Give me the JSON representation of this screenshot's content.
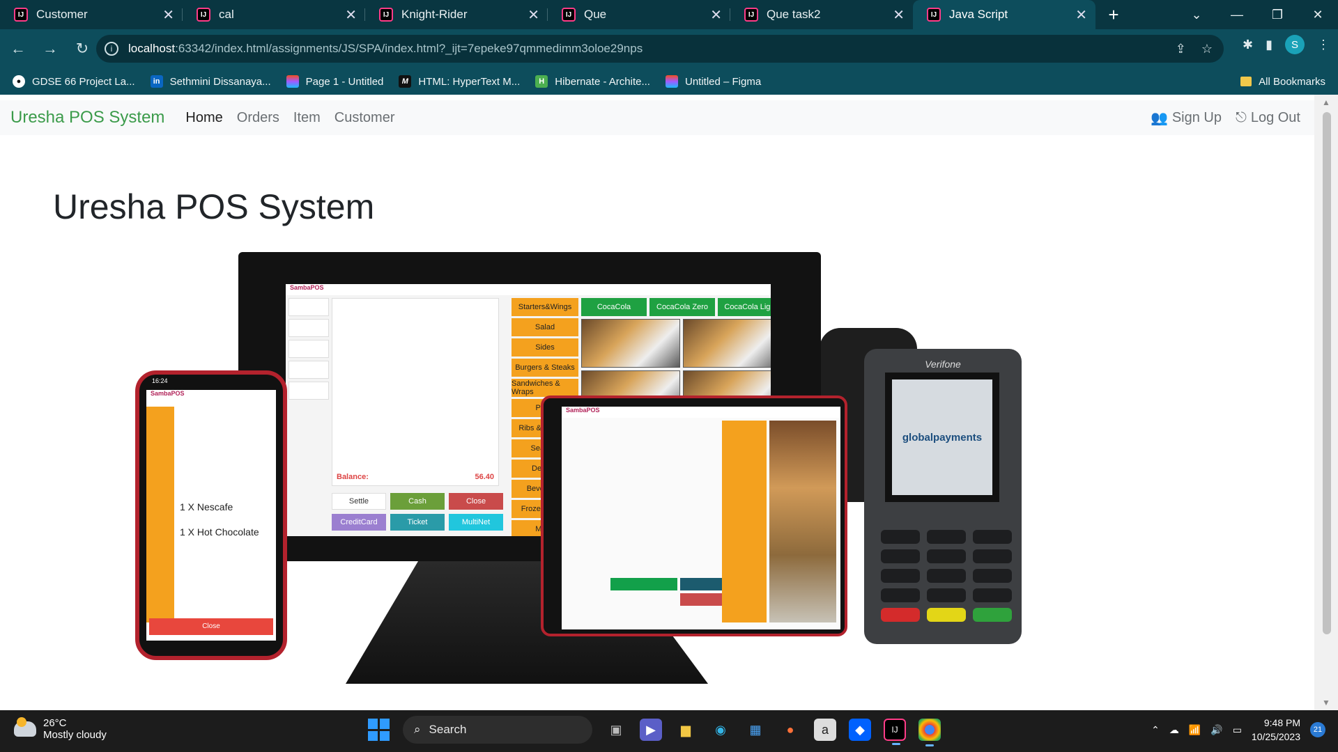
{
  "browser": {
    "tabs": [
      {
        "label": "Customer",
        "active": false
      },
      {
        "label": "cal",
        "active": false
      },
      {
        "label": "Knight-Rider",
        "active": false
      },
      {
        "label": "Que",
        "active": false
      },
      {
        "label": "Que task2",
        "active": false
      },
      {
        "label": "Java Script",
        "active": true
      }
    ],
    "url_host": "localhost",
    "url_rest": ":63342/index.html/assignments/JS/SPA/index.html?_ijt=7epeke97qmmedimm3oloe29nps",
    "profile_initial": "S",
    "bookmarks": [
      {
        "label": "GDSE 66 Project La...",
        "icon": "github-icon"
      },
      {
        "label": "Sethmini Dissanaya...",
        "icon": "linkedin-icon"
      },
      {
        "label": "Page 1 - Untitled",
        "icon": "figma-icon"
      },
      {
        "label": "HTML: HyperText M...",
        "icon": "mdn-icon"
      },
      {
        "label": "Hibernate - Archite...",
        "icon": "hibernate-icon"
      },
      {
        "label": "Untitled – Figma",
        "icon": "figma-icon"
      }
    ],
    "all_bookmarks_label": "All Bookmarks"
  },
  "page": {
    "brand": "Uresha POS System",
    "nav": [
      {
        "label": "Home",
        "active": true
      },
      {
        "label": "Orders",
        "active": false
      },
      {
        "label": "Item",
        "active": false
      },
      {
        "label": "Customer",
        "active": false
      }
    ],
    "sign_up": "Sign Up",
    "log_out": "Log Out",
    "hero_title": "Uresha POS System",
    "hero_image": {
      "screen_brand": "SambaPOS",
      "categories": [
        "Starters&Wings",
        "Salad",
        "Sides",
        "Burgers & Steaks",
        "Sandwiches & Wraps",
        "Pizza",
        "Ribs & Chicken",
        "Seafood",
        "Dessert",
        "Beverages",
        "Frozen Drinks",
        "Menu"
      ],
      "drinks": [
        "CocaCola",
        "CocaCola Zero",
        "CocaCola Light"
      ],
      "balance_label": "Balance:",
      "balance_value": "56.40",
      "pay_buttons": [
        "Settle",
        "Cash",
        "Close",
        "CreditCard",
        "Ticket",
        "MultiNet"
      ],
      "phone_time": "16:24",
      "phone_items": [
        "1 X Nescafe",
        "1 X Hot Chocolate"
      ],
      "phone_close": "Close",
      "terminal_brand": "Verifone",
      "terminal_display": "globalpayments"
    }
  },
  "taskbar": {
    "temperature": "26°C",
    "weather": "Mostly cloudy",
    "search_placeholder": "Search",
    "time": "9:48 PM",
    "date": "10/25/2023",
    "notifications": "21"
  }
}
